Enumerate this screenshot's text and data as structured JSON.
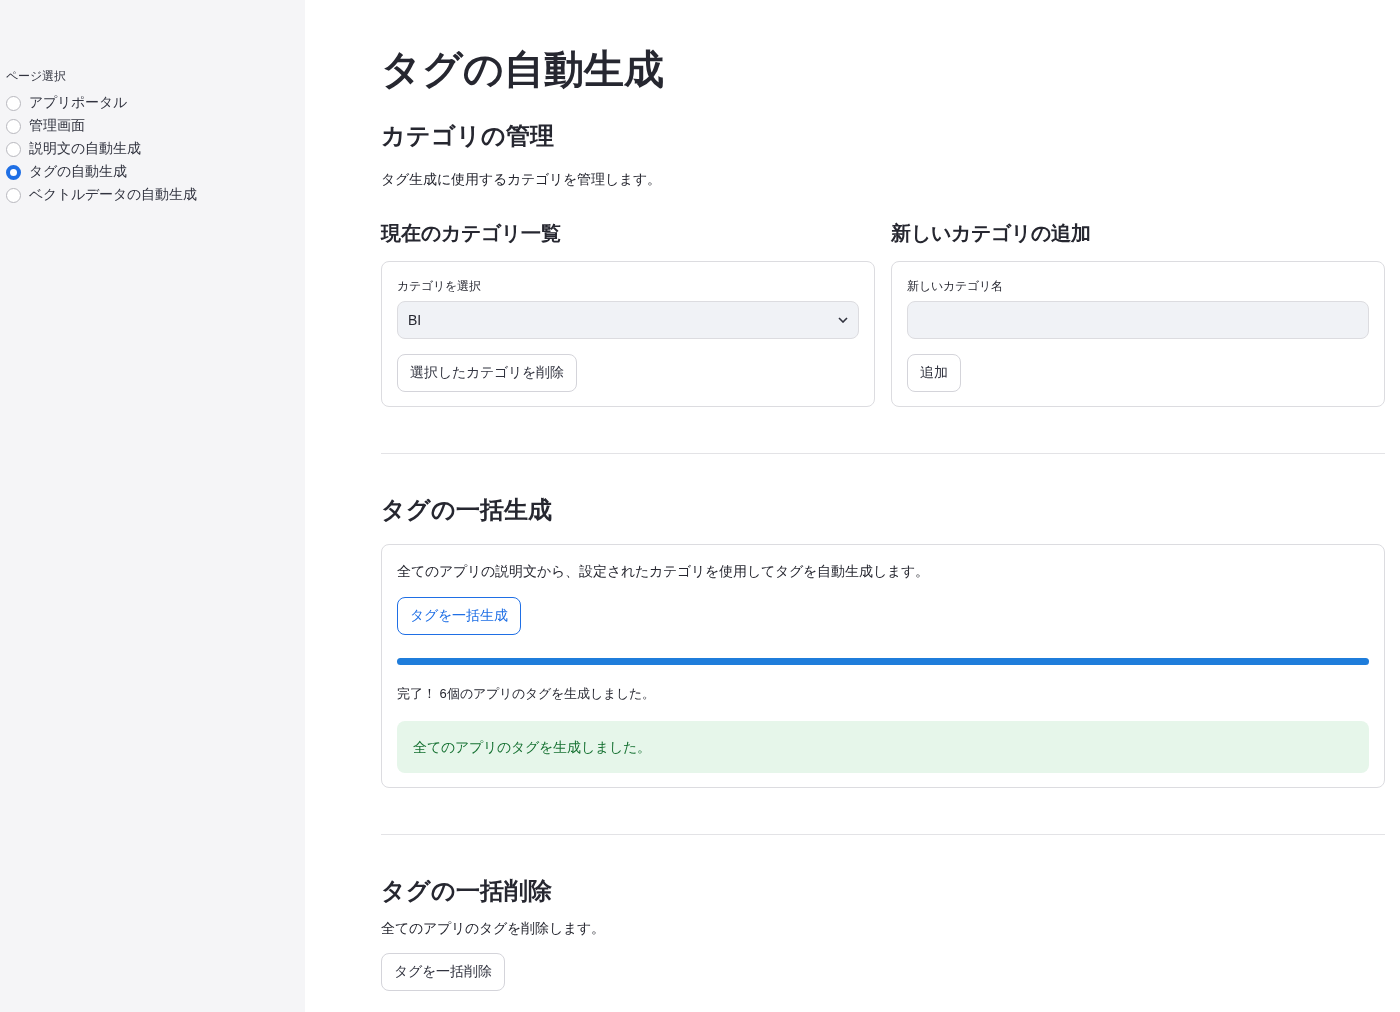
{
  "sidebar": {
    "label": "ページ選択",
    "items": [
      {
        "label": "アプリポータル",
        "selected": false
      },
      {
        "label": "管理画面",
        "selected": false
      },
      {
        "label": "説明文の自動生成",
        "selected": false
      },
      {
        "label": "タグの自動生成",
        "selected": true
      },
      {
        "label": "ベクトルデータの自動生成",
        "selected": false
      }
    ]
  },
  "title": "タグの自動生成",
  "category_section": {
    "heading": "カテゴリの管理",
    "description": "タグ生成に使用するカテゴリを管理します。",
    "current": {
      "heading": "現在のカテゴリ一覧",
      "select_label": "カテゴリを選択",
      "select_value": "BI",
      "delete_button": "選択したカテゴリを削除"
    },
    "add": {
      "heading": "新しいカテゴリの追加",
      "input_label": "新しいカテゴリ名",
      "add_button": "追加"
    }
  },
  "bulk_generate": {
    "heading": "タグの一括生成",
    "description": "全てのアプリの説明文から、設定されたカテゴリを使用してタグを自動生成します。",
    "button": "タグを一括生成",
    "progress": {
      "level": 1
    },
    "progress_text": "完了！ 6個のアプリのタグを生成しました。",
    "success_message": "全てのアプリのタグを生成しました。"
  },
  "bulk_delete": {
    "heading": "タグの一括削除",
    "description": "全てのアプリのタグを削除します。",
    "button": "タグを一括削除"
  }
}
